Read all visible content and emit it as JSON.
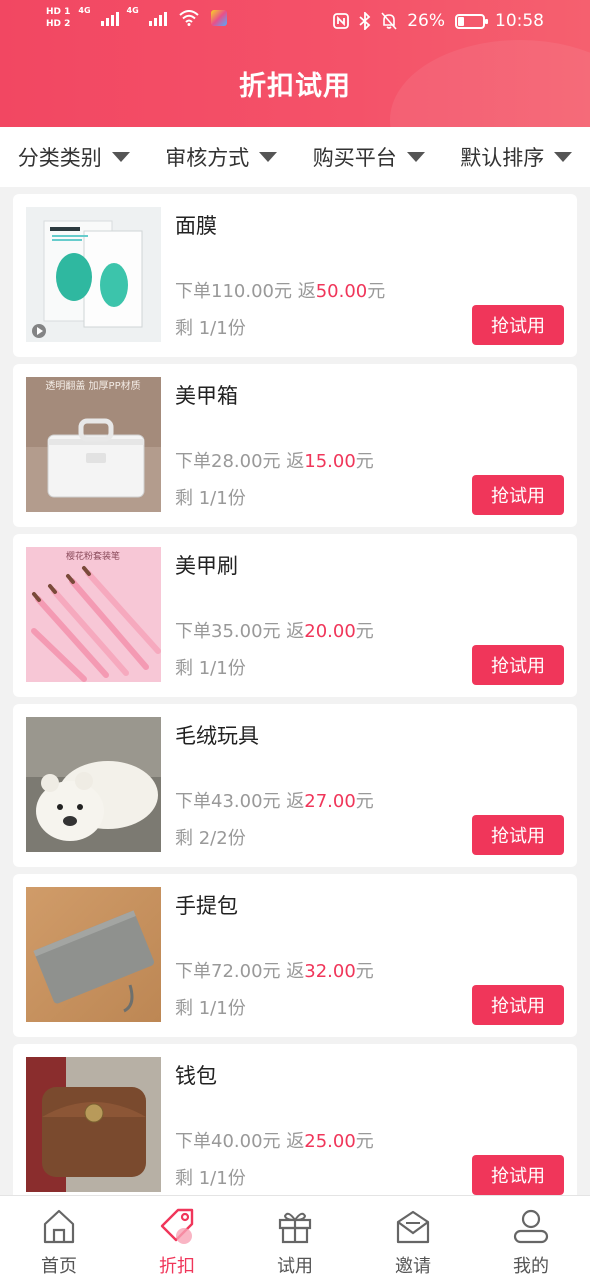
{
  "status_bar": {
    "hd1": "HD 1",
    "hd2": "HD 2",
    "net1": "4G",
    "net2": "4G",
    "battery_percent": "26%",
    "battery_level": 0.26,
    "time": "10:58"
  },
  "header": {
    "title": "折扣试用"
  },
  "filters": [
    {
      "label": "分类类别"
    },
    {
      "label": "审核方式"
    },
    {
      "label": "购买平台"
    },
    {
      "label": "默认排序"
    }
  ],
  "currency_unit": "元",
  "price_prefix": "下单",
  "rebate_prefix": "返",
  "stock_prefix": "剩",
  "stock_suffix": "份",
  "button_label": "抢试用",
  "products": [
    {
      "name": "面膜",
      "order_price": "110.00",
      "rebate": "50.00",
      "stock": "1/1",
      "image": "face-mask-box"
    },
    {
      "name": "美甲箱",
      "order_price": "28.00",
      "rebate": "15.00",
      "stock": "1/1",
      "image": "nail-box",
      "image_caption": "透明翻盖 加厚PP材质"
    },
    {
      "name": "美甲刷",
      "order_price": "35.00",
      "rebate": "20.00",
      "stock": "1/1",
      "image": "nail-brushes",
      "image_caption": "樱花粉套装笔"
    },
    {
      "name": "毛绒玩具",
      "order_price": "43.00",
      "rebate": "27.00",
      "stock": "2/2",
      "image": "plush-bear"
    },
    {
      "name": "手提包",
      "order_price": "72.00",
      "rebate": "32.00",
      "stock": "1/1",
      "image": "gray-clutch"
    },
    {
      "name": "钱包",
      "order_price": "40.00",
      "rebate": "25.00",
      "stock": "1/1",
      "image": "brown-wallet"
    }
  ],
  "bottom_nav": [
    {
      "label": "首页",
      "icon": "home-icon",
      "active": false
    },
    {
      "label": "折扣",
      "icon": "tag-icon",
      "active": true
    },
    {
      "label": "试用",
      "icon": "gift-icon",
      "active": false
    },
    {
      "label": "邀请",
      "icon": "mail-icon",
      "active": false
    },
    {
      "label": "我的",
      "icon": "user-icon",
      "active": false
    }
  ],
  "colors": {
    "brand": "#f24762",
    "accent": "#f0365a",
    "muted_text": "#999999"
  }
}
